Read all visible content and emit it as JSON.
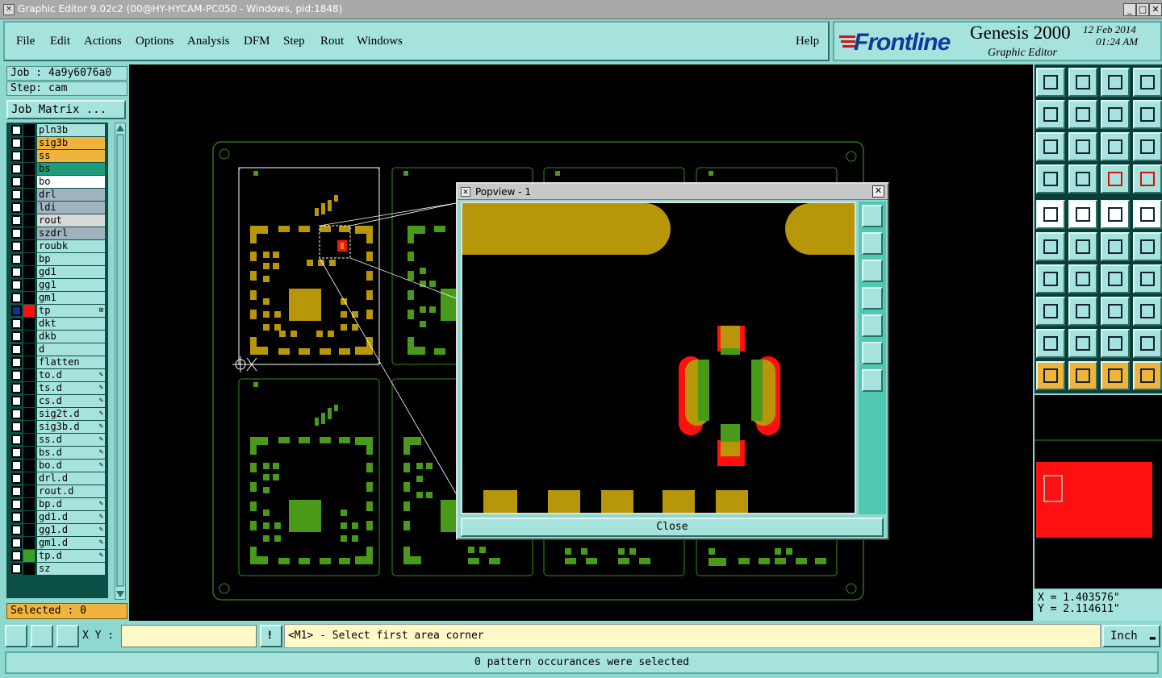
{
  "window": {
    "title": "Graphic Editor 9.02c2 (00@HY-HYCAM-PC050 - Windows, pid:1848)",
    "minimize": "_",
    "maximize": "□",
    "close": "✕"
  },
  "menu": {
    "items": [
      "File",
      "Edit",
      "Actions",
      "Options",
      "Analysis",
      "DFM",
      "Step",
      "Rout",
      "Windows"
    ],
    "help": "Help"
  },
  "branding": {
    "logo": "Frontline",
    "product": "Genesis 2000",
    "subtitle": "Graphic Editor",
    "date": "12 Feb 2014",
    "time": "01:24 AM"
  },
  "job": {
    "job_label": "Job : 4a9y6076a0",
    "step_label": "Step: cam",
    "job_matrix": "Job Matrix ...",
    "selected": "Selected : 0"
  },
  "layers": [
    {
      "name": "pln3b",
      "color": "#a6e3dc",
      "swatch": "#000"
    },
    {
      "name": "sig3b",
      "color": "#f0b33c",
      "swatch": "#000"
    },
    {
      "name": "ss",
      "color": "#f0b33c",
      "swatch": "#000"
    },
    {
      "name": "bs",
      "color": "#1f9a7a",
      "swatch": "#000"
    },
    {
      "name": "bo",
      "color": "#ffffff",
      "swatch": "#000"
    },
    {
      "name": "drl",
      "color": "#9fb3bf",
      "swatch": "#000"
    },
    {
      "name": "ldi",
      "color": "#9fb3bf",
      "swatch": "#000"
    },
    {
      "name": "rout",
      "color": "#d9d9d9",
      "swatch": "#000"
    },
    {
      "name": "szdrl",
      "color": "#9fb3bf",
      "swatch": "#000"
    },
    {
      "name": "roubk",
      "color": "#a6e3dc",
      "swatch": "#000"
    },
    {
      "name": "bp",
      "color": "#a6e3dc",
      "swatch": "#000"
    },
    {
      "name": "gd1",
      "color": "#a6e3dc",
      "swatch": "#000"
    },
    {
      "name": "gg1",
      "color": "#a6e3dc",
      "swatch": "#000"
    },
    {
      "name": "gm1",
      "color": "#a6e3dc",
      "swatch": "#000"
    },
    {
      "name": "tp",
      "color": "#a6e3dc",
      "swatch": "#ff1010",
      "mark": "⊞",
      "active": true
    },
    {
      "name": "dkt",
      "color": "#a6e3dc",
      "swatch": "#000"
    },
    {
      "name": "dkb",
      "color": "#a6e3dc",
      "swatch": "#000"
    },
    {
      "name": "d",
      "color": "#a6e3dc",
      "swatch": "#000"
    },
    {
      "name": "flatten",
      "color": "#a6e3dc",
      "swatch": "#000"
    },
    {
      "name": "to.d",
      "color": "#a6e3dc",
      "swatch": "#000",
      "mark": "✎"
    },
    {
      "name": "ts.d",
      "color": "#a6e3dc",
      "swatch": "#000",
      "mark": "✎"
    },
    {
      "name": "cs.d",
      "color": "#a6e3dc",
      "swatch": "#000",
      "mark": "✎"
    },
    {
      "name": "sig2t.d",
      "color": "#a6e3dc",
      "swatch": "#000",
      "mark": "✎"
    },
    {
      "name": "sig3b.d",
      "color": "#a6e3dc",
      "swatch": "#000",
      "mark": "✎"
    },
    {
      "name": "ss.d",
      "color": "#a6e3dc",
      "swatch": "#000",
      "mark": "✎"
    },
    {
      "name": "bs.d",
      "color": "#a6e3dc",
      "swatch": "#000",
      "mark": "✎"
    },
    {
      "name": "bo.d",
      "color": "#a6e3dc",
      "swatch": "#000",
      "mark": "✎"
    },
    {
      "name": "drl.d",
      "color": "#a6e3dc",
      "swatch": "#000"
    },
    {
      "name": "rout.d",
      "color": "#a6e3dc",
      "swatch": "#000"
    },
    {
      "name": "bp.d",
      "color": "#a6e3dc",
      "swatch": "#000",
      "mark": "✎"
    },
    {
      "name": "gd1.d",
      "color": "#a6e3dc",
      "swatch": "#000",
      "mark": "✎"
    },
    {
      "name": "gg1.d",
      "color": "#a6e3dc",
      "swatch": "#000",
      "mark": "✎"
    },
    {
      "name": "gm1.d",
      "color": "#a6e3dc",
      "swatch": "#000",
      "mark": "✎"
    },
    {
      "name": "tp.d",
      "color": "#a6e3dc",
      "swatch": "#3aa02a",
      "mark": "✎"
    },
    {
      "name": "sz",
      "color": "#a6e3dc",
      "swatch": "#000"
    }
  ],
  "popview": {
    "title": "Popview - 1",
    "close_label": "Close",
    "close_x": "✕"
  },
  "coords": {
    "x": "X = 1.403576\"",
    "y": "Y = 2.114611\""
  },
  "bottom": {
    "xy_label": "X Y :",
    "xy_value": "",
    "prompt": "<M1> - Select first area corner",
    "units": "Inch",
    "status": "0 pattern occurances were selected"
  },
  "colors": {
    "pad_gold": "#b8960a",
    "pad_green": "#4a9a1a",
    "outline": "#3a8a1c",
    "highlight_red": "#ff1010",
    "background": "#000000"
  },
  "right_tools": [
    "open-icon",
    "save-icon",
    "home-icon",
    "panel-icon",
    "in-icon",
    "out-icon",
    "undo-icon",
    "rotate-icon",
    "fit-icon",
    "pan-icon",
    "ratio-icon",
    "help-icon",
    "measure-icon",
    "grid-icon",
    "snap-icon",
    "snap-red-icon",
    "select-icon",
    "draw-icon",
    "ruler-icon",
    "circle-icon",
    "connect-icon",
    "cross-icon",
    "move-icon",
    "copy-icon",
    "line-icon",
    "slope-icon",
    "arc-icon",
    "mirror-icon",
    "pad-icon",
    "horizontal-icon",
    "width-icon",
    "group-icon",
    "triangle1-icon",
    "triangle2-icon",
    "triangle3-icon",
    "triangle4-icon",
    "pointer-icon",
    "pointer-box-icon",
    "pointer-circle-icon",
    "pointer-net-icon"
  ]
}
